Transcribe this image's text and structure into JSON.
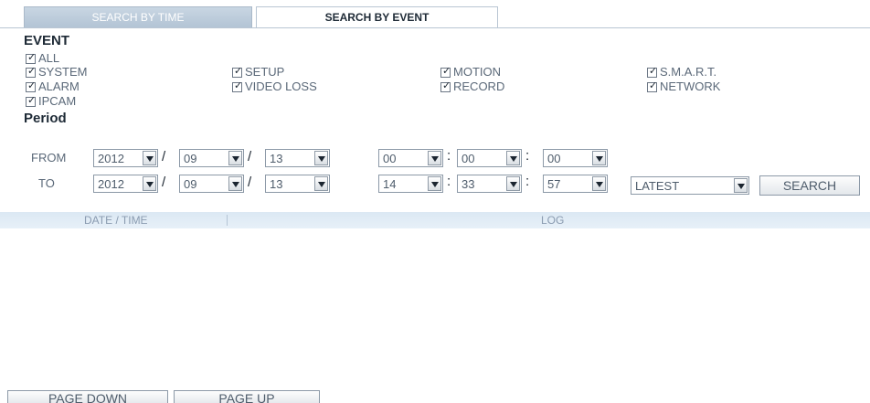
{
  "tabs": [
    {
      "label": "SEARCH BY TIME",
      "active": false
    },
    {
      "label": "SEARCH BY EVENT",
      "active": true
    }
  ],
  "event": {
    "title": "EVENT",
    "checkboxes": {
      "all": {
        "label": "ALL",
        "checked": true
      },
      "system": {
        "label": "SYSTEM",
        "checked": true
      },
      "setup": {
        "label": "SETUP",
        "checked": true
      },
      "motion": {
        "label": "MOTION",
        "checked": true
      },
      "smart": {
        "label": "S.M.A.R.T.",
        "checked": true
      },
      "alarm": {
        "label": "ALARM",
        "checked": true
      },
      "video_loss": {
        "label": "VIDEO LOSS",
        "checked": true
      },
      "record": {
        "label": "RECORD",
        "checked": true
      },
      "network": {
        "label": "NETWORK",
        "checked": true
      },
      "ipcam": {
        "label": "IPCAM",
        "checked": true
      }
    }
  },
  "period": {
    "title": "Period",
    "from": {
      "label": "FROM",
      "year": "2012",
      "month": "09",
      "day": "13",
      "hour": "00",
      "minute": "00",
      "second": "00"
    },
    "to": {
      "label": "TO",
      "year": "2012",
      "month": "09",
      "day": "13",
      "hour": "14",
      "minute": "33",
      "second": "57"
    },
    "date_separator": "/",
    "time_separator": ":",
    "order": "LATEST",
    "search_label": "SEARCH"
  },
  "log": {
    "columns": [
      "DATE / TIME",
      "LOG"
    ]
  },
  "pagination": {
    "page_down": "PAGE DOWN",
    "page_up": "PAGE UP"
  },
  "colors": {
    "tab_inactive": "#b2c3d4",
    "header_band": "#dbe8f3",
    "text": "#5a6878",
    "title": "#1e2a36"
  }
}
